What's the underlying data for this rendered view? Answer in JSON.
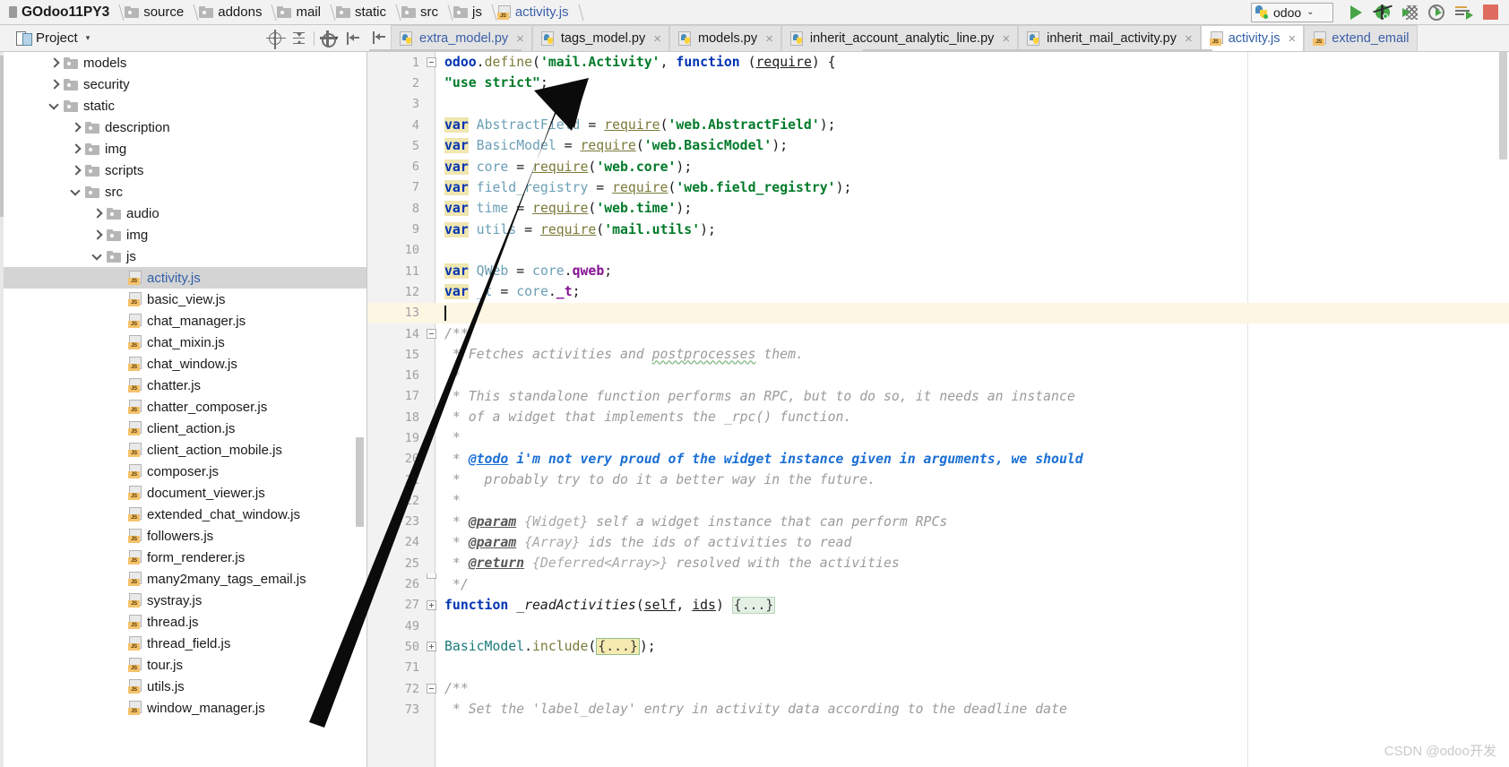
{
  "navbar": {
    "breadcrumb": [
      {
        "label": "GOdoo11PY3",
        "icon": "module-icon",
        "type": "root"
      },
      {
        "label": "source",
        "icon": "folder-icon",
        "type": "folder"
      },
      {
        "label": "addons",
        "icon": "folder-icon",
        "type": "folder"
      },
      {
        "label": "mail",
        "icon": "folder-icon",
        "type": "folder"
      },
      {
        "label": "static",
        "icon": "folder-icon",
        "type": "folder"
      },
      {
        "label": "src",
        "icon": "folder-icon",
        "type": "folder"
      },
      {
        "label": "js",
        "icon": "folder-icon",
        "type": "folder"
      },
      {
        "label": "activity.js",
        "icon": "js-file-icon",
        "type": "file"
      }
    ],
    "run_config": {
      "label": "odoo",
      "icon": "python-icon",
      "dropdown": "⌄"
    },
    "buttons": [
      {
        "name": "run-button",
        "icon": "play-icon"
      },
      {
        "name": "debug-button",
        "icon": "bug-icon"
      },
      {
        "name": "coverage-button",
        "icon": "coverage-icon"
      },
      {
        "name": "profile-button",
        "icon": "profile-icon"
      },
      {
        "name": "run-with-params-button",
        "icon": "run-lines-icon"
      },
      {
        "name": "stop-button",
        "icon": "stop-square-icon"
      }
    ]
  },
  "project_panel": {
    "title": "Project",
    "caret": "▾",
    "tools": [
      {
        "name": "locate-file-icon"
      },
      {
        "name": "collapse-all-icon"
      },
      {
        "name": "settings-gear-icon"
      },
      {
        "name": "hide-panel-icon"
      }
    ]
  },
  "tabs": [
    {
      "label": "extra_model.py",
      "icon": "python-file-icon",
      "active": false,
      "blue": true,
      "close": "×"
    },
    {
      "label": "tags_model.py",
      "icon": "python-file-icon",
      "active": false,
      "blue": false,
      "close": "×"
    },
    {
      "label": "models.py",
      "icon": "python-file-icon",
      "active": false,
      "blue": false,
      "close": "×"
    },
    {
      "label": "inherit_account_analytic_line.py",
      "icon": "python-file-icon",
      "active": false,
      "blue": false,
      "close": "×"
    },
    {
      "label": "inherit_mail_activity.py",
      "icon": "python-file-icon",
      "active": false,
      "blue": false,
      "close": "×"
    },
    {
      "label": "activity.js",
      "icon": "js-file-icon",
      "active": true,
      "blue": true,
      "close": "×"
    },
    {
      "label": "extend_email",
      "icon": "js-file-icon",
      "active": false,
      "blue": true,
      "close": ""
    }
  ],
  "tree": [
    {
      "label": "models",
      "icon": "folder-icon",
      "arrow": "right",
      "depth": 2,
      "selected": false
    },
    {
      "label": "security",
      "icon": "folder-icon",
      "arrow": "right",
      "depth": 2,
      "selected": false
    },
    {
      "label": "static",
      "icon": "folder-icon",
      "arrow": "down",
      "depth": 2,
      "selected": false
    },
    {
      "label": "description",
      "icon": "folder-icon",
      "arrow": "right",
      "depth": 3,
      "selected": false
    },
    {
      "label": "img",
      "icon": "folder-icon",
      "arrow": "right",
      "depth": 3,
      "selected": false
    },
    {
      "label": "scripts",
      "icon": "folder-icon",
      "arrow": "right",
      "depth": 3,
      "selected": false
    },
    {
      "label": "src",
      "icon": "folder-icon",
      "arrow": "down",
      "depth": 3,
      "selected": false
    },
    {
      "label": "audio",
      "icon": "folder-icon",
      "arrow": "right",
      "depth": 4,
      "selected": false
    },
    {
      "label": "img",
      "icon": "folder-icon",
      "arrow": "right",
      "depth": 4,
      "selected": false
    },
    {
      "label": "js",
      "icon": "folder-icon",
      "arrow": "down",
      "depth": 4,
      "selected": false
    },
    {
      "label": "activity.js",
      "icon": "js-file-icon",
      "arrow": "none",
      "depth": 5,
      "selected": true
    },
    {
      "label": "basic_view.js",
      "icon": "js-file-icon",
      "arrow": "none",
      "depth": 5,
      "selected": false
    },
    {
      "label": "chat_manager.js",
      "icon": "js-file-icon",
      "arrow": "none",
      "depth": 5,
      "selected": false
    },
    {
      "label": "chat_mixin.js",
      "icon": "js-file-icon",
      "arrow": "none",
      "depth": 5,
      "selected": false
    },
    {
      "label": "chat_window.js",
      "icon": "js-file-icon",
      "arrow": "none",
      "depth": 5,
      "selected": false
    },
    {
      "label": "chatter.js",
      "icon": "js-file-icon",
      "arrow": "none",
      "depth": 5,
      "selected": false
    },
    {
      "label": "chatter_composer.js",
      "icon": "js-file-icon",
      "arrow": "none",
      "depth": 5,
      "selected": false
    },
    {
      "label": "client_action.js",
      "icon": "js-file-icon",
      "arrow": "none",
      "depth": 5,
      "selected": false
    },
    {
      "label": "client_action_mobile.js",
      "icon": "js-file-icon",
      "arrow": "none",
      "depth": 5,
      "selected": false
    },
    {
      "label": "composer.js",
      "icon": "js-file-icon",
      "arrow": "none",
      "depth": 5,
      "selected": false
    },
    {
      "label": "document_viewer.js",
      "icon": "js-file-icon",
      "arrow": "none",
      "depth": 5,
      "selected": false
    },
    {
      "label": "extended_chat_window.js",
      "icon": "js-file-icon",
      "arrow": "none",
      "depth": 5,
      "selected": false
    },
    {
      "label": "followers.js",
      "icon": "js-file-icon",
      "arrow": "none",
      "depth": 5,
      "selected": false
    },
    {
      "label": "form_renderer.js",
      "icon": "js-file-icon",
      "arrow": "none",
      "depth": 5,
      "selected": false
    },
    {
      "label": "many2many_tags_email.js",
      "icon": "js-file-icon",
      "arrow": "none",
      "depth": 5,
      "selected": false
    },
    {
      "label": "systray.js",
      "icon": "js-file-icon",
      "arrow": "none",
      "depth": 5,
      "selected": false
    },
    {
      "label": "thread.js",
      "icon": "js-file-icon",
      "arrow": "none",
      "depth": 5,
      "selected": false
    },
    {
      "label": "thread_field.js",
      "icon": "js-file-icon",
      "arrow": "none",
      "depth": 5,
      "selected": false
    },
    {
      "label": "tour.js",
      "icon": "js-file-icon",
      "arrow": "none",
      "depth": 5,
      "selected": false
    },
    {
      "label": "utils.js",
      "icon": "js-file-icon",
      "arrow": "none",
      "depth": 5,
      "selected": false
    },
    {
      "label": "window_manager.js",
      "icon": "js-file-icon",
      "arrow": "none",
      "depth": 5,
      "selected": false
    }
  ],
  "editor": {
    "filename": "activity.js",
    "cursor_line": 13,
    "lines": [
      {
        "num": "1",
        "fold": "minus"
      },
      {
        "num": "2",
        "fold": ""
      },
      {
        "num": "3",
        "fold": ""
      },
      {
        "num": "4",
        "fold": ""
      },
      {
        "num": "5",
        "fold": ""
      },
      {
        "num": "6",
        "fold": ""
      },
      {
        "num": "7",
        "fold": ""
      },
      {
        "num": "8",
        "fold": ""
      },
      {
        "num": "9",
        "fold": ""
      },
      {
        "num": "10",
        "fold": ""
      },
      {
        "num": "11",
        "fold": ""
      },
      {
        "num": "12",
        "fold": ""
      },
      {
        "num": "13",
        "fold": ""
      },
      {
        "num": "14",
        "fold": "minus"
      },
      {
        "num": "15",
        "fold": ""
      },
      {
        "num": "16",
        "fold": ""
      },
      {
        "num": "17",
        "fold": ""
      },
      {
        "num": "18",
        "fold": ""
      },
      {
        "num": "19",
        "fold": ""
      },
      {
        "num": "20",
        "fold": ""
      },
      {
        "num": "21",
        "fold": ""
      },
      {
        "num": "22",
        "fold": ""
      },
      {
        "num": "23",
        "fold": ""
      },
      {
        "num": "24",
        "fold": ""
      },
      {
        "num": "25",
        "fold": ""
      },
      {
        "num": "26",
        "fold": "end"
      },
      {
        "num": "27",
        "fold": "plus"
      },
      {
        "num": "49",
        "fold": ""
      },
      {
        "num": "50",
        "fold": "plus"
      },
      {
        "num": "71",
        "fold": ""
      },
      {
        "num": "72",
        "fold": "minus"
      },
      {
        "num": "73",
        "fold": ""
      }
    ],
    "source_text": [
      "odoo.define('mail.Activity', function (require) {",
      "\"use strict\";",
      "",
      "var AbstractField = require('web.AbstractField');",
      "var BasicModel = require('web.BasicModel');",
      "var core = require('web.core');",
      "var field_registry = require('web.field_registry');",
      "var time = require('web.time');",
      "var utils = require('mail.utils');",
      "",
      "var QWeb = core.qweb;",
      "var _t = core._t;",
      "",
      "/**",
      " * Fetches activities and postprocesses them.",
      " *",
      " * This standalone function performs an RPC, but to do so, it needs an instance",
      " * of a widget that implements the _rpc() function.",
      " *",
      " * @todo i'm not very proud of the widget instance given in arguments, we should",
      " *   probably try to do it a better way in the future.",
      " *",
      " * @param {Widget} self a widget instance that can perform RPCs",
      " * @param {Array} ids the ids of activities to read",
      " * @return {Deferred<Array>} resolved with the activities",
      " */",
      "function _readActivities(self, ids) {...}",
      "",
      "BasicModel.include({...});",
      "",
      "/**",
      " * Set the 'label_delay' entry in activity data according to the deadline date"
    ]
  },
  "watermark": "CSDN @odoo开发"
}
